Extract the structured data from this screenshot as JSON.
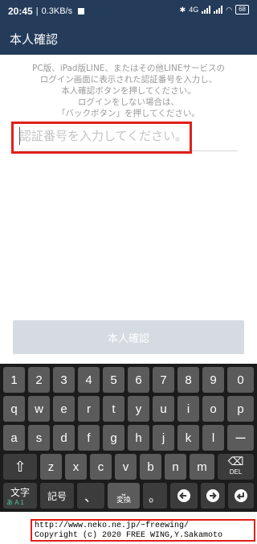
{
  "status_bar": {
    "time": "20:45",
    "network_speed": "0.3KB/s",
    "signal_label": "4G",
    "battery": "68"
  },
  "app_bar": {
    "title": "本人確認"
  },
  "instruction": {
    "lines": [
      "PC版、iPad版LINE、またはその他LINEサービスの",
      "ログイン画面に表示された認証番号を入力し、",
      "本人確認ボタンを押してください。",
      "ログインをしない場合は、",
      "「バックボタン」を押してください。"
    ]
  },
  "code_input": {
    "placeholder": "認証番号を入力してください。",
    "value": ""
  },
  "confirm_button": {
    "label": "本人確認"
  },
  "keyboard": {
    "row1": [
      "1",
      "2",
      "3",
      "4",
      "5",
      "6",
      "7",
      "8",
      "9",
      "0"
    ],
    "row2": [
      "q",
      "w",
      "e",
      "r",
      "t",
      "y",
      "u",
      "i",
      "o",
      "p"
    ],
    "row3": [
      "a",
      "s",
      "d",
      "f",
      "g",
      "h",
      "j",
      "k",
      "l",
      "ー"
    ],
    "row4": [
      "z",
      "x",
      "c",
      "v",
      "b",
      "n",
      "m"
    ],
    "mode_label": "文字",
    "mode_sub": "あ A 1",
    "symbols_label": "記号",
    "comma_label": "、",
    "space_label": "変換",
    "period_label": "。",
    "delete_label": "DEL"
  },
  "copyright": {
    "line1": "http://www.neko.ne.jp/~freewing/",
    "line2": "Copyright (c) 2020 FREE WING,Y.Sakamoto"
  }
}
